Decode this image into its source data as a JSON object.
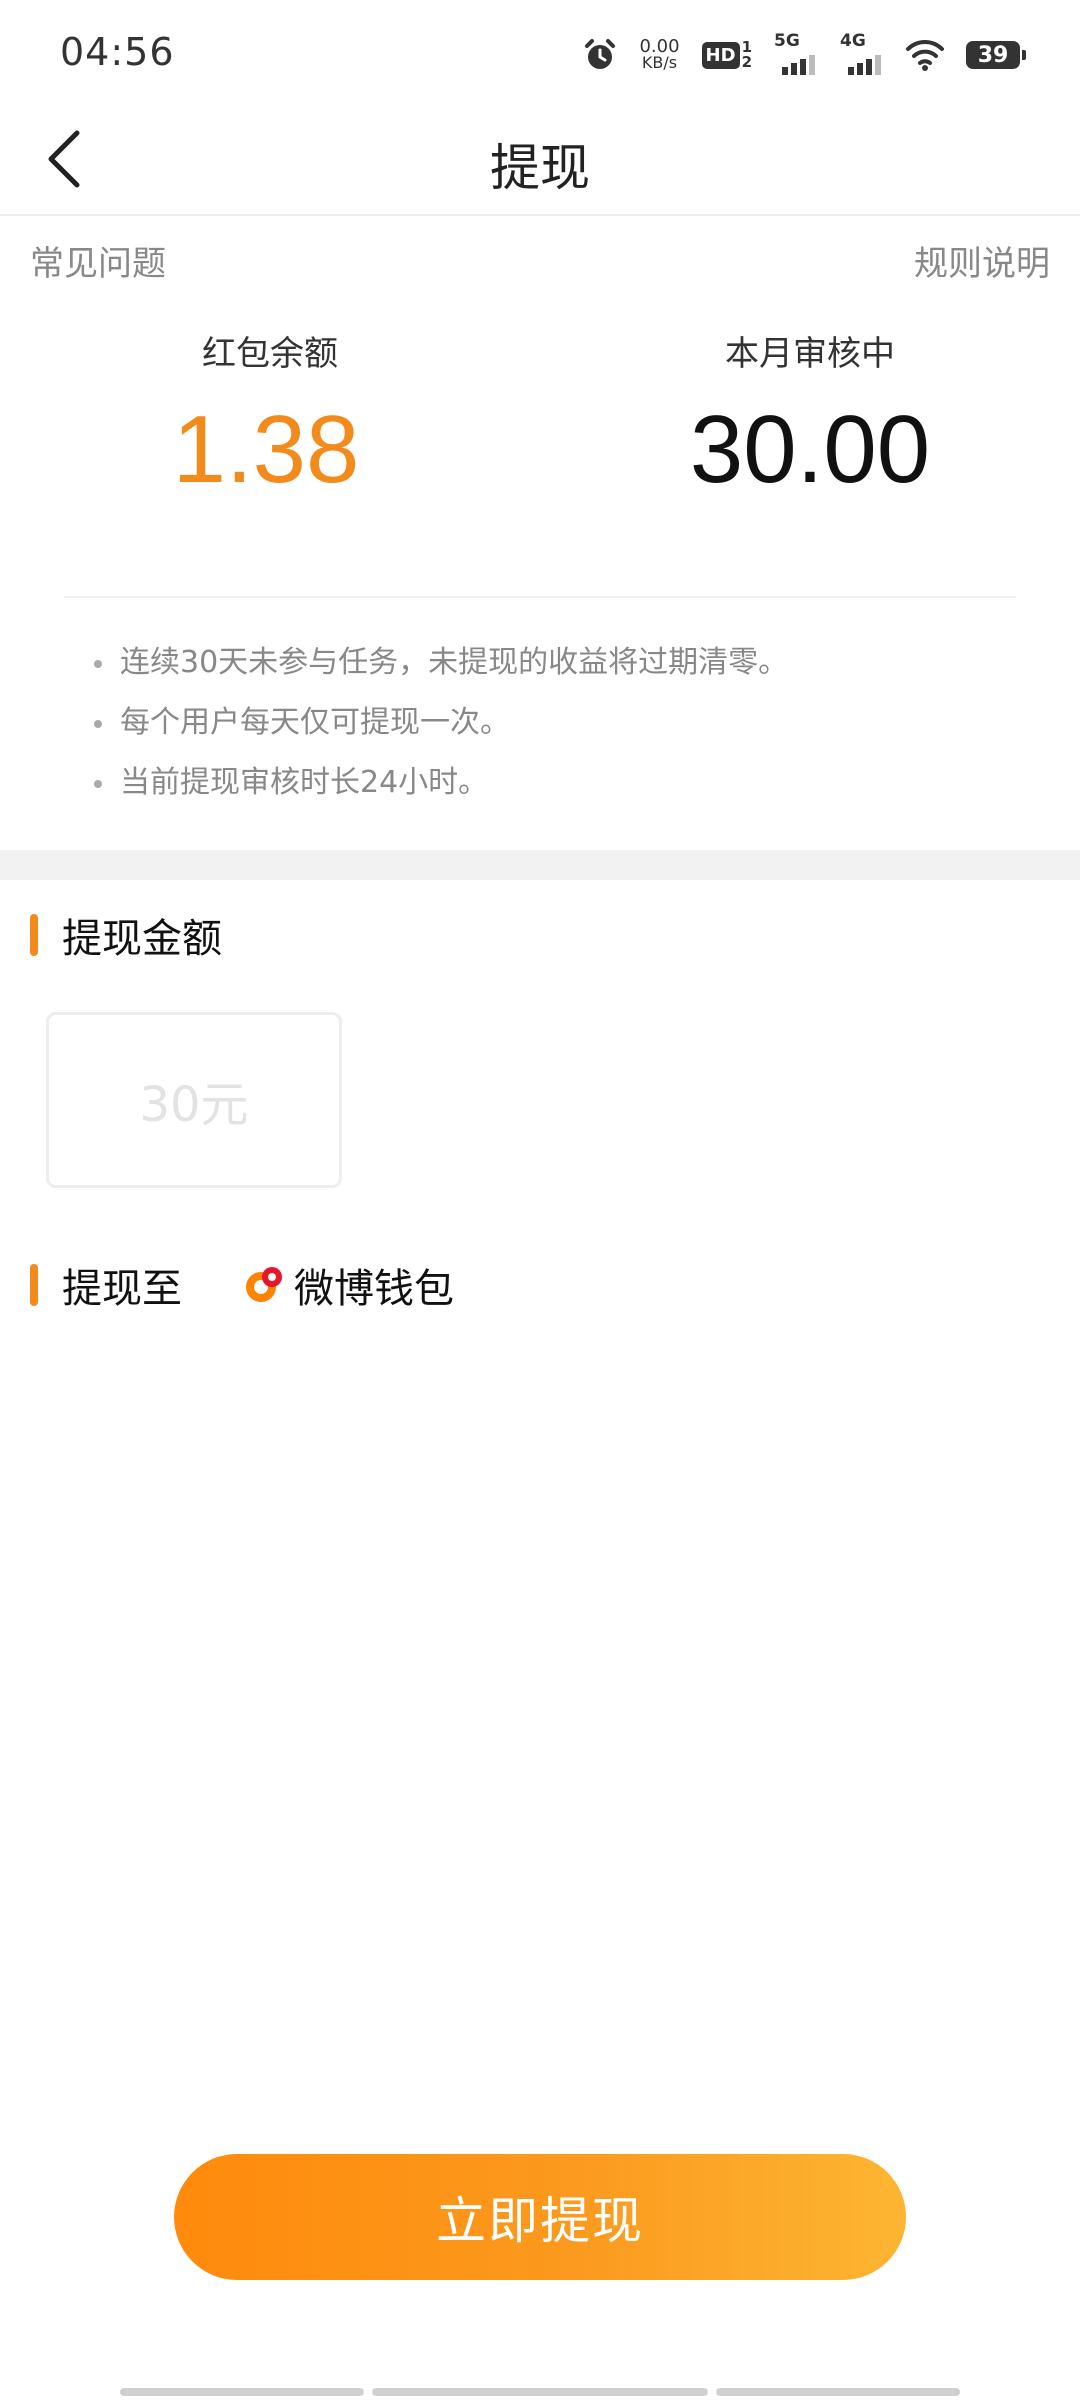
{
  "status_bar": {
    "time": "04:56",
    "net_speed_value": "0.00",
    "net_speed_unit": "KB/s",
    "hd_label": "HD",
    "hd_sub": "2",
    "hd_sup": "1",
    "cell1_label": "5G",
    "cell2_label": "4G",
    "battery": "39",
    "icons": [
      "alarm-icon",
      "hd-icon",
      "signal-5g-icon",
      "signal-4g-icon",
      "wifi-icon",
      "battery-icon"
    ]
  },
  "nav": {
    "title": "提现",
    "back_icon": "chevron-left-icon"
  },
  "links": {
    "faq": "常见问题",
    "rules": "规则说明"
  },
  "stats": {
    "balance_label": "红包余额",
    "balance_value": "1.38",
    "pending_label": "本月审核中",
    "pending_value": "30.00"
  },
  "notes": [
    "连续30天未参与任务，未提现的收益将过期清零。",
    "每个用户每天仅可提现一次。",
    "当前提现审核时长24小时。"
  ],
  "amount_section": {
    "title": "提现金额",
    "option": "30元"
  },
  "destination_section": {
    "title": "提现至",
    "wallet_name": "微博钱包",
    "wallet_icon": "weibo-wallet-icon"
  },
  "withdraw_button": "立即提现",
  "colors": {
    "accent": "#f38a1c",
    "button_start": "#ff8a0c",
    "button_end": "#fdb532"
  }
}
